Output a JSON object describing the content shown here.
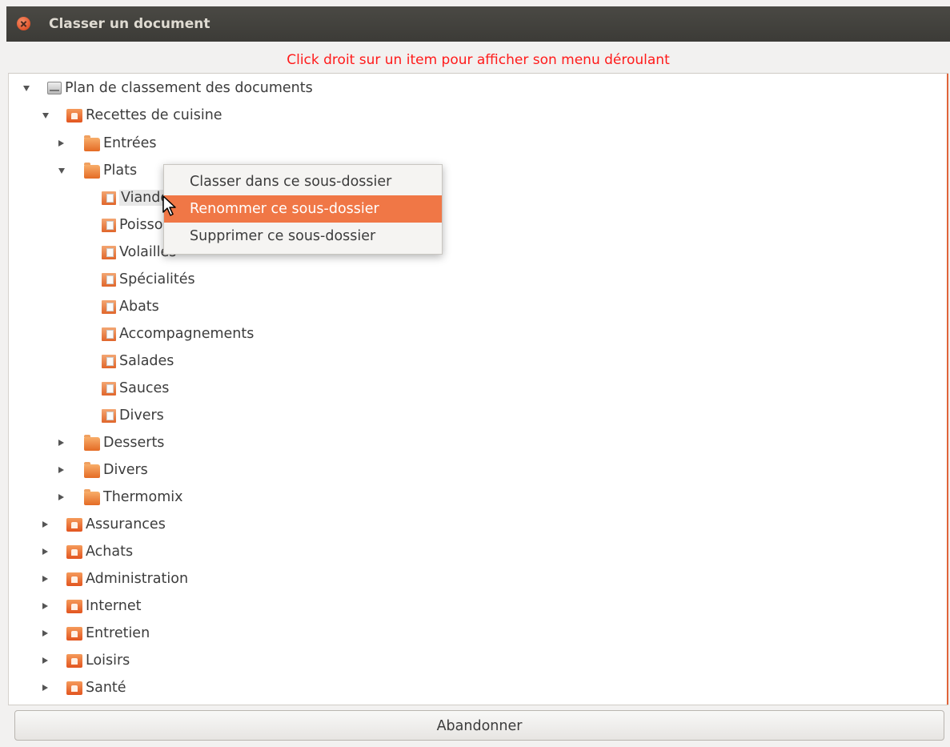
{
  "window": {
    "title": "Classer un document"
  },
  "hint": "Click droit sur un item pour afficher son menu déroulant",
  "tree": {
    "root": "Plan de classement des documents",
    "recettes": "Recettes de cuisine",
    "entrees": "Entrées",
    "plats": "Plats",
    "viandes": "Viandes",
    "poissons": "Poissons",
    "volailles": "Volailles",
    "specialites": "Spécialités",
    "abats": "Abats",
    "accompagnements": "Accompagnements",
    "salades": "Salades",
    "sauces": "Sauces",
    "divers_plats": "Divers",
    "desserts": "Desserts",
    "divers": "Divers",
    "thermomix": "Thermomix",
    "assurances": "Assurances",
    "achats": "Achats",
    "administration": "Administration",
    "internet": "Internet",
    "entretien": "Entretien",
    "loisirs": "Loisirs",
    "sante": "Santé"
  },
  "context_menu": {
    "items": [
      "Classer dans ce sous-dossier",
      "Renommer ce sous-dossier",
      "Supprimer ce sous-dossier"
    ],
    "highlighted_index": 1
  },
  "buttons": {
    "abandon": "Abandonner"
  },
  "colors": {
    "hint": "#ff1a1a",
    "menu_highlight": "#f07746",
    "titlebar": "#3c3b37"
  }
}
